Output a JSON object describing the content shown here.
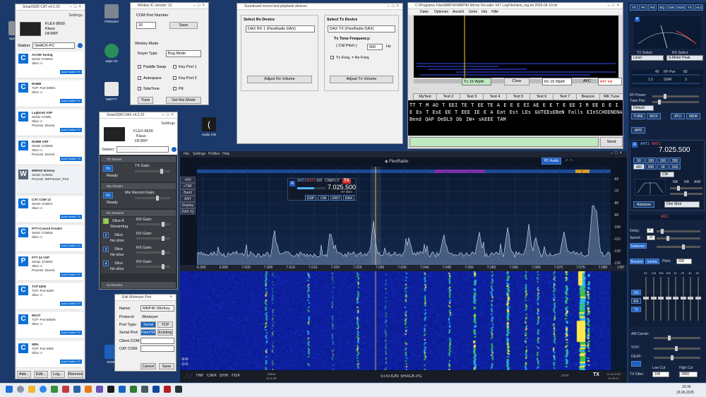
{
  "desktop_icons": [
    {
      "label": "Speicher",
      "color": "#c64a3a"
    },
    {
      "label": "FRStack4",
      "color": "#7d8591"
    },
    {
      "label": "wsjtx X3",
      "color": "#2a8f5a"
    },
    {
      "label": "MMTTY",
      "color": "#e8e8e8"
    },
    {
      "label": "Audio CW",
      "color": "#f0a000"
    },
    {
      "label": "N1MM",
      "color": "#1b5fb8"
    }
  ],
  "smartsdr_cat": {
    "title": "SmartSDR CAT v4.2.20",
    "settings": "Settings",
    "radio": {
      "model": "FLEX-8600",
      "nick": "Klaus",
      "call": "DF3RP"
    },
    "station_label": "Station:",
    "station_value": "SHACK-PC",
    "items": [
      {
        "icon": "C",
        "l1": "ACOM Tuning",
        "l2": "Serial: COM10",
        "l3": "Slice: A",
        "auto": "Auto Switch TX"
      },
      {
        "icon": "C",
        "l1": "N1MM",
        "l2": "TCP: Port 60001",
        "l3": "Slice: A",
        "auto": "Auto Switch TX"
      },
      {
        "icon": "C",
        "l1": "Logbook VSP",
        "l2": "Serial: COM5",
        "l3": "Slice: A",
        "l4": "Process: (None)",
        "auto": "Auto Switch TX"
      },
      {
        "icon": "C",
        "l1": "N1MM VSP",
        "l2": "Serial: COM30",
        "l3": "Slice: A",
        "l4": "Process: (None)",
        "auto": "Auto Switch TX"
      },
      {
        "icon": "W",
        "l1": "MRP40 WinKey",
        "l2": "Serial: COM20",
        "l3": "Process: MRP40v67_PKS"
      },
      {
        "icon": "C",
        "l1": "CAT COM 13",
        "l2": "Serial: COM12",
        "l3": "Slice: A",
        "auto": "Auto Switch TX"
      },
      {
        "icon": "C",
        "l1": "PTT+Com10 FreeDV",
        "l2": "Serial: COM18",
        "l3": "Slice: A",
        "auto": "Auto Switch TX"
      },
      {
        "icon": "P",
        "l1": "PTT 24 VSP",
        "l2": "Serial: COM24",
        "l3": "Slice: A",
        "l4": "Process: (None)",
        "auto": "Auto Switch TX"
      },
      {
        "icon": "C",
        "l1": "TCP 5200",
        "l2": "TCP: Port 5200",
        "l3": "Slice: A",
        "auto": "Auto Switch TX"
      },
      {
        "icon": "C",
        "l1": "WSJT",
        "l2": "TCP: Port 60000",
        "l3": "Slice: A",
        "auto": "Auto Switch TX"
      },
      {
        "icon": "C",
        "l1": "WRL",
        "l2": "TCP: Port 4992",
        "l3": "Slice: A",
        "auto": "Auto Switch TX"
      }
    ],
    "buttons": [
      "Add...",
      "Edit...",
      "Log...",
      "Remove"
    ]
  },
  "winkey": {
    "title": "Winkey IC version: 31",
    "com_port_label": "COM Port Number",
    "com_port_value": "20",
    "save": "Save",
    "mode_label": "Winkey Mode",
    "keyer_type_label": "Keyer Type",
    "keyer_type_value": "Bug Mode",
    "checks": [
      "Paddle Swap",
      "Key Port 1",
      "Autospace",
      "Key Port 2",
      "SideTone",
      "Ptt"
    ],
    "tune": "Tune",
    "set_mode": "Set this Mode"
  },
  "soundcard": {
    "title": "Soundcard record and playback devices",
    "rx_label": "Select Rx Device",
    "rx_value": "DAX RX 1 (FlexRadio DAX)",
    "adjust_rx": "Adjust Rx Volume",
    "tx_label": "Select Tx Device",
    "tx_value": "DAX TX (FlexRadio DAX)",
    "tone_label": "Tx Tone Frequency:",
    "pitch_label": "( CW Pitch )",
    "pitch_value": "600",
    "hz": "Hz",
    "txfreq": "Tx Freq.  = Rx Freq.",
    "adjust_tx": "Adjust Tx Volume"
  },
  "mrp40": {
    "title": "C:\\Programs Files\\MRP40\\MRP40 Morse Decoder V67 LogFiles\\text_log.txt 2025-06-19.txt",
    "menu": [
      "Datei",
      "Optionen",
      "Ansicht",
      "Gehe",
      "Info",
      "Hilfe"
    ],
    "tx_wpm": "Tx 15 WpM",
    "clear": "Clear",
    "rx_wpm": "Rx 15 WpM",
    "afc": "AFC",
    "hz_value": "647 Hz",
    "tabs": [
      "MyText",
      "Text 2",
      "Text 3",
      "Text 4",
      "Text 5",
      "Text 6",
      "Text 7",
      "Beacon",
      "WK Tune"
    ],
    "decoded": "TT  T M  AO  T EEI  TE  T EE  TE  A E E E EI  AE  E  E  T  E EE  I  R EE  E E I  E Es T  EsE EE  T EEE IE E  A  Eat  Est  LEs  GUTEEsEBeN  Falls  EInSCHOENENA  Bend  QAP  DeDL9  Db  IW+  skEEE   TAM",
    "send": "Send"
  },
  "dax": {
    "title": "SmartSDR DAX v4.2.20",
    "settings": "Settings",
    "radio": {
      "model": "FLEX-8600",
      "nick": "Klaus",
      "call": "DF3RP"
    },
    "station_label": "Station:",
    "station_value": "SHACK-PC",
    "tx_streams": "TX Stream",
    "on": "On",
    "ready": "Ready",
    "tx_gain": "TX Gain:",
    "mic_streams": "Mic Stream",
    "mic_gain": "Mic Record Gain:",
    "rx_streams": "RX Streams",
    "rx_gain": "RX Gain:",
    "slice_a": "Slice A",
    "streaming": "Streaming",
    "slice": "Slice",
    "no_slice": "No slice",
    "iq_streams": "IQ Streams",
    "stream_nums": [
      "1",
      "2",
      "3",
      "4"
    ]
  },
  "edit_winkey": {
    "title": "Edit Winkeyer Port",
    "name_label": "Name:",
    "name_value": "MRP40 WinKey",
    "protocol_label": "Protocol:",
    "protocol_value": "Winkeyer",
    "port_type_label": "Port Type:",
    "serial": "Serial",
    "tcp": "TCP",
    "serial_port_label": "Serial Port:",
    "flexvsp": "FlexVSP",
    "existing": "Existing",
    "client_com": "Client COM:",
    "cat_com": "CAT COM:",
    "cancel": "Cancel",
    "save": "Save"
  },
  "flex": {
    "menu": [
      "File",
      "Settings",
      "Profiles",
      "Help"
    ],
    "brand": "FlexRadio",
    "pc_audio": "PC Audio",
    "side": [
      "+RX",
      "+TNF",
      "Band",
      "ANT",
      "Display",
      "DAX IQ"
    ],
    "slice_letter": "A",
    "ant1": "ANT1",
    "ant2": "ANT2",
    "bw": "400",
    "mode": "CW",
    "split": "SPLIT",
    "tx": "TX",
    "freq": "7.025.500",
    "dbm": "-87 dBm",
    "slice_btns": [
      "DSP",
      "CW",
      "XRIT",
      "DAX"
    ],
    "freq_ticks": [
      "6.990",
      "6.995",
      "7.000",
      "7.005",
      "7.010",
      "7.015",
      "7.020",
      "7.025",
      "7.030",
      "7.035",
      "7.040",
      "7.045",
      "7.050",
      "7.055",
      "7.060",
      "7.065",
      "7.070",
      "7.075",
      "7.080"
    ],
    "db_ticks": [
      "-60",
      "-70",
      "-80",
      "-90",
      "-100",
      "-110",
      "-120",
      "-130"
    ],
    "lnt": "LNT",
    "status_items": [
      "TNF",
      "CWX",
      "DVK",
      "FDX"
    ],
    "station_label": "STATION:",
    "station_value": "SHACK-PC",
    "gps": "UNIX",
    "volts": "Klaus",
    "version": "v4.2.20",
    "time": "14.06.2025",
    "time2": "16:36:12"
  },
  "right_panel": {
    "tabs": [
      "TX",
      "PA",
      "RX",
      "EQ",
      "CW",
      "VOX",
      "TX",
      "ALC"
    ],
    "tx_select": "TX Select",
    "rx_select": "RX Select",
    "tx_select_val": "Level",
    "rx_select_val": "S-Meter Peak",
    "rf_power_label": "RF Power:",
    "tune_power_label": "Tune Pwr:",
    "profile": "Default",
    "tune": "TUNE",
    "mox": "MOX",
    "atu": "ATU",
    "mem": "MEM",
    "apd": "APD",
    "slice_letter": "A",
    "ant1": "ANT1",
    "ant2": "ANT2",
    "freq": "7.025.500",
    "filter_btns": [
      "50",
      "100",
      "150",
      "250",
      "400",
      "500",
      "1K",
      "1K5"
    ],
    "mode": "CW",
    "autotune": "Autotune",
    "oneshot": "One Shot",
    "nb": "NB",
    "nr": "NR",
    "anf": "ANF",
    "agc": "AGC",
    "delay_label": "Delay:",
    "speed_label": "Speed:",
    "sidetone_label": "Sidetone:",
    "delay_val": "5",
    "speed_val": "15",
    "breakin": "Breakin",
    "iambic": "Iambic",
    "pitch_label": "Pitch:",
    "pitch_val": "600",
    "meter_scale": [
      "40",
      "RF Pwr",
      "80",
      "1.5",
      "SWR",
      "3"
    ],
    "eq_labels": [
      "63",
      "125",
      "250",
      "500",
      "1K",
      "2K",
      "4K",
      "8K"
    ],
    "on": "ON",
    "rx": "RX",
    "tx_btn": "TX",
    "am_carrier": "AM Carrier:",
    "vox_label": "VOX:",
    "dexp_label": "DEXP:",
    "low_cut": "Low Cut",
    "high_cut": "High Cut",
    "tx_filter_label": "TX Filter:",
    "low_cut_val": "100",
    "high_cut_val": "2900"
  },
  "taskbar": {
    "clock": "20:36",
    "date": "18.06.2025"
  }
}
